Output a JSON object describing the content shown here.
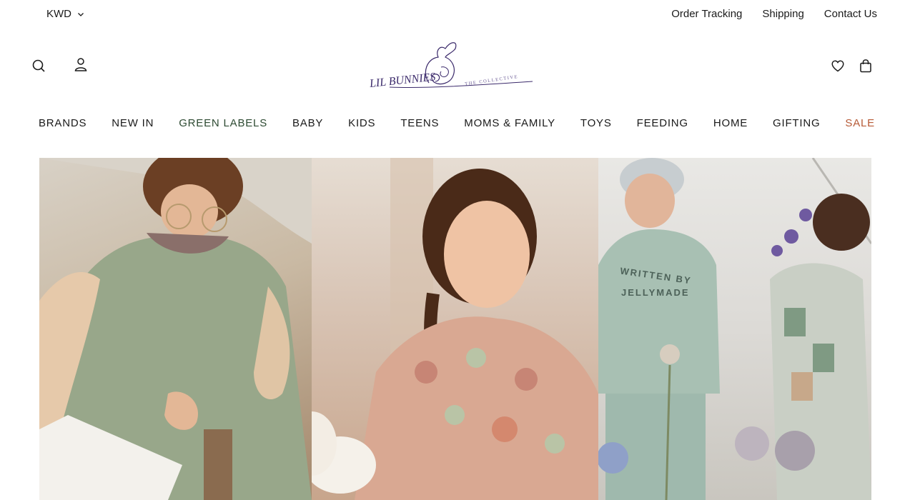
{
  "topbar": {
    "currency": "KWD",
    "links": [
      "Order Tracking",
      "Shipping",
      "Contact Us"
    ]
  },
  "logo": {
    "main_text": "LIL BUNNIES",
    "sub_text": "THE COLLECTIVE"
  },
  "nav": {
    "items": [
      "BRANDS",
      "NEW IN",
      "GREEN LABELS",
      "BABY",
      "KIDS",
      "TEENS",
      "MOMS & FAMILY",
      "TOYS",
      "FEEDING",
      "HOME",
      "GIFTING",
      "SALE"
    ]
  },
  "hero": {
    "sweatshirt_print_line1": "WRITTEN BY",
    "sweatshirt_print_line2": "JELLYMADE"
  },
  "colors": {
    "green_label": "#2d4a32",
    "sale": "#b65a36",
    "logo_purple": "#3b2a6b"
  }
}
